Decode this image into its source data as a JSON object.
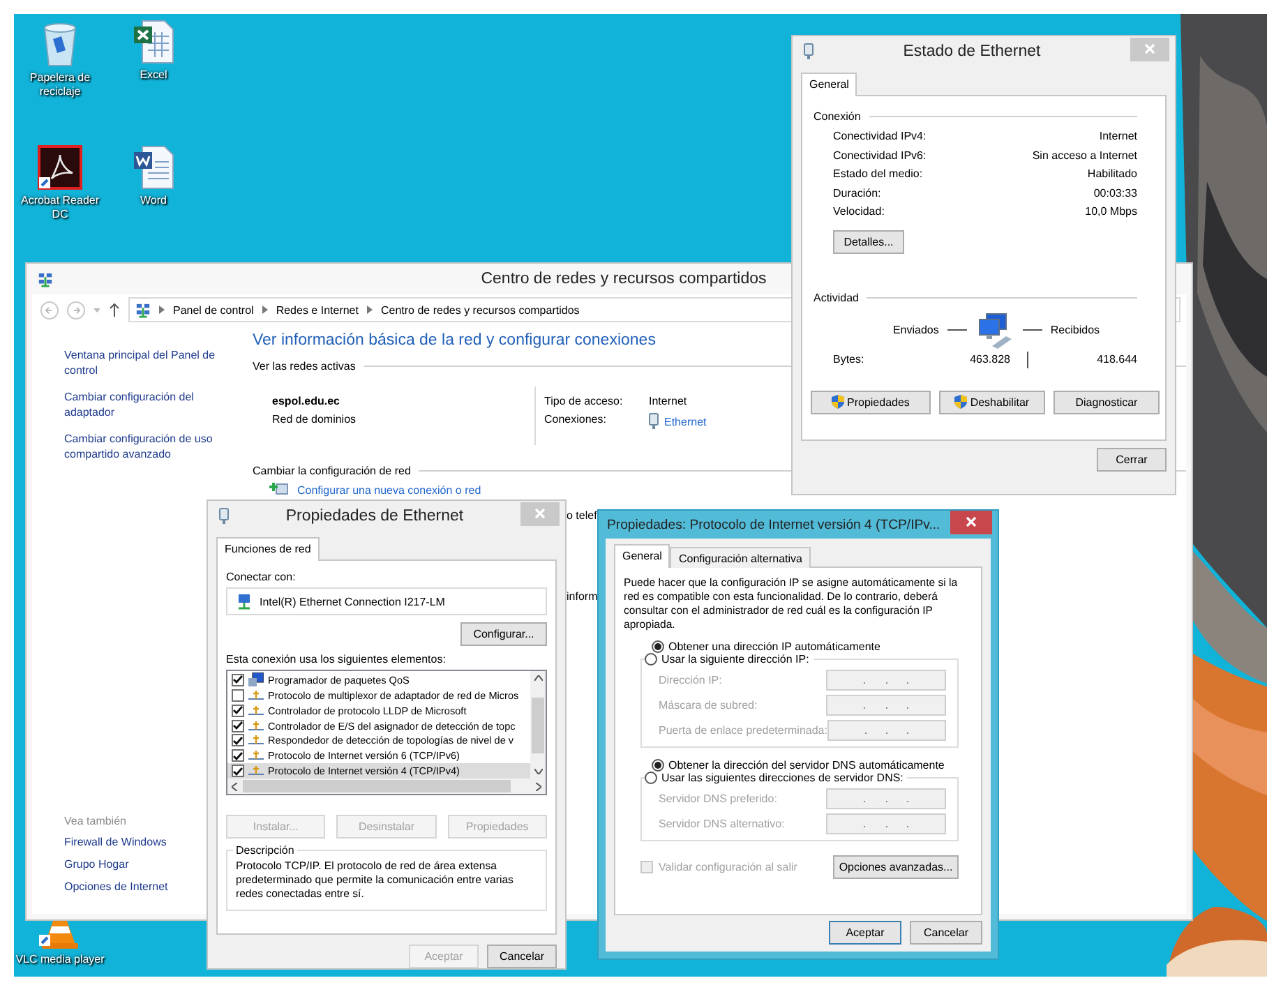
{
  "desktop_icons": [
    {
      "kind": "recycle",
      "label": "Papelera de reciclaje"
    },
    {
      "kind": "excel",
      "label": "Excel"
    },
    {
      "kind": "acrobat",
      "label": "Acrobat Reader DC"
    },
    {
      "kind": "word",
      "label": "Word"
    },
    {
      "kind": "vlc",
      "label": "VLC media player"
    }
  ],
  "network_center": {
    "title": "Centro de redes y recursos compartidos",
    "breadcrumb": [
      "Panel de control",
      "Redes e Internet",
      "Centro de redes y recursos compartidos"
    ],
    "sidebar_links": [
      "Ventana principal del Panel de control",
      "Cambiar configuración del adaptador",
      "Cambiar configuración de uso compartido avanzado"
    ],
    "see_also_title": "Vea también",
    "see_also": [
      "Firewall de Windows",
      "Grupo Hogar",
      "Opciones de Internet"
    ],
    "heading": "Ver información básica de la red y configurar conexiones",
    "active_networks_title": "Ver las redes activas",
    "network": {
      "name": "espol.edu.ec",
      "type": "Red de dominios",
      "access_label": "Tipo de acceso:",
      "access_value": "Internet",
      "connections_label": "Conexiones:",
      "connection": "Ethernet"
    },
    "change_title": "Cambiar la configuración de red",
    "task": "Configurar una nueva conexión o red",
    "fragments": [
      "o telef",
      "inform"
    ]
  },
  "status_window": {
    "title": "Estado de Ethernet",
    "tabs": [
      {
        "label": "General",
        "selected": true
      }
    ],
    "connection_title": "Conexión",
    "rows": [
      {
        "label": "Conectividad IPv4:",
        "value": "Internet"
      },
      {
        "label": "Conectividad IPv6:",
        "value": "Sin acceso a Internet"
      },
      {
        "label": "Estado del medio:",
        "value": "Habilitado"
      },
      {
        "label": "Duración:",
        "value": "00:03:33"
      },
      {
        "label": "Velocidad:",
        "value": "10,0 Mbps"
      }
    ],
    "details_button": "Detalles...",
    "activity_title": "Actividad",
    "sent_label": "Enviados",
    "received_label": "Recibidos",
    "bytes_label": "Bytes:",
    "bytes_sent": "463.828",
    "bytes_received": "418.644",
    "buttons": [
      {
        "label": "Propiedades",
        "shield": true
      },
      {
        "label": "Deshabilitar",
        "shield": true
      },
      {
        "label": "Diagnosticar",
        "shield": false
      }
    ],
    "close_button": "Cerrar"
  },
  "ethernet_properties": {
    "title": "Propiedades de Ethernet",
    "tabs": [
      {
        "label": "Funciones de red",
        "selected": true
      }
    ],
    "connect_label": "Conectar con:",
    "adapter": "Intel(R) Ethernet Connection I217-LM",
    "configure_button": "Configurar...",
    "items_label": "Esta conexión usa los siguientes elementos:",
    "items": [
      {
        "kind": "service",
        "label": "Programador de paquetes QoS",
        "checked": true,
        "selected": false
      },
      {
        "kind": "protocol",
        "label": "Protocolo de multiplexor de adaptador de red de Micros",
        "checked": false,
        "selected": false
      },
      {
        "kind": "protocol",
        "label": "Controlador de protocolo LLDP de Microsoft",
        "checked": true,
        "selected": false
      },
      {
        "kind": "protocol",
        "label": "Controlador de E/S del asignador de detección de topc",
        "checked": true,
        "selected": false
      },
      {
        "kind": "protocol",
        "label": "Respondedor de detección de topologías de nivel de v",
        "checked": true,
        "selected": false
      },
      {
        "kind": "protocol",
        "label": "Protocolo de Internet versión 6 (TCP/IPv6)",
        "checked": true,
        "selected": false
      },
      {
        "kind": "protocol",
        "label": "Protocolo de Internet versión 4 (TCP/IPv4)",
        "checked": true,
        "selected": true
      }
    ],
    "buttons": [
      {
        "label": "Instalar...",
        "disabled": true
      },
      {
        "label": "Desinstalar",
        "disabled": true
      },
      {
        "label": "Propiedades",
        "disabled": true
      }
    ],
    "description_title": "Descripción",
    "description": "Protocolo TCP/IP. El protocolo de red de área extensa predeterminado que permite la comunicación entre varias redes conectadas entre sí.",
    "footer_buttons": [
      {
        "label": "Aceptar",
        "disabled": true
      },
      {
        "label": "Cancelar",
        "disabled": false
      }
    ]
  },
  "ipv4_properties": {
    "title": "Propiedades: Protocolo de Internet versión 4 (TCP/IPv...",
    "tabs": [
      {
        "label": "General",
        "selected": true
      },
      {
        "label": "Configuración alternativa",
        "selected": false
      }
    ],
    "intro": "Puede hacer que la configuración IP se asigne automáticamente si la red es compatible con esta funcionalidad. De lo contrario, deberá consultar con el administrador de red cuál es la configuración IP apropiada.",
    "ip_options": [
      {
        "label": "Obtener una dirección IP automáticamente",
        "selected": true
      },
      {
        "label": "Usar la siguiente dirección IP:",
        "selected": false
      }
    ],
    "ip_fields": [
      {
        "label": "Dirección IP:",
        "disabled": true
      },
      {
        "label": "Máscara de subred:",
        "disabled": true
      },
      {
        "label": "Puerta de enlace predeterminada:",
        "disabled": true
      }
    ],
    "dns_options": [
      {
        "label": "Obtener la dirección del servidor DNS automáticamente",
        "selected": true
      },
      {
        "label": "Usar las siguientes direcciones de servidor DNS:",
        "selected": false
      }
    ],
    "dns_fields": [
      {
        "label": "Servidor DNS preferido:",
        "disabled": true
      },
      {
        "label": "Servidor DNS alternativo:",
        "disabled": true
      }
    ],
    "validate": {
      "label": "Validar configuración al salir",
      "checked": false,
      "disabled": true
    },
    "advanced_button": "Opciones avanzadas...",
    "footer_buttons": [
      {
        "label": "Aceptar",
        "default": true
      },
      {
        "label": "Cancelar",
        "default": false
      }
    ]
  }
}
